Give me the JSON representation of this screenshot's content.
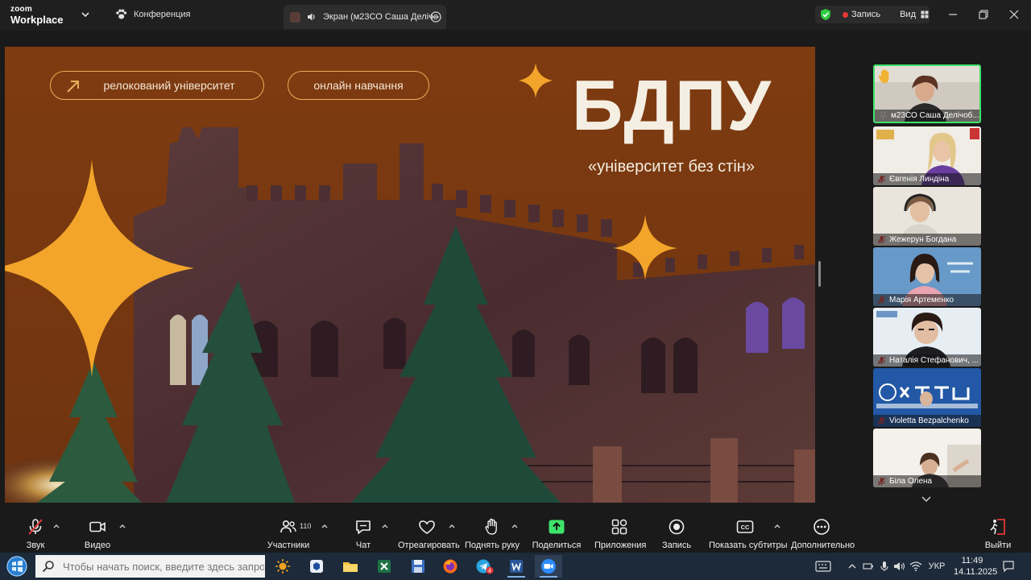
{
  "titlebar": {
    "brand_top": "zoom",
    "brand_bottom": "Workplace",
    "conference_label": "Конференция",
    "share_tab_label": "Экран (м23СО Саша Делічо",
    "record_label": "Запись",
    "view_label": "Вид"
  },
  "slide": {
    "pill_relocated": "релокований університет",
    "pill_online": "онлайн навчання",
    "title": "БДПУ",
    "subtitle": "«університет без стін»",
    "colors": {
      "background": "#7e3a10",
      "star": "#f2a52a",
      "text": "#f5eee2"
    }
  },
  "participants": [
    {
      "name": "м23СО Саша Делічоб...",
      "active": true,
      "hand_raised": true
    },
    {
      "name": "Євгенія Линдіна",
      "active": false
    },
    {
      "name": "Жежерун Богдана",
      "active": false
    },
    {
      "name": "Марія Артеменко",
      "active": false
    },
    {
      "name": "Наталія Стефанович, ...",
      "active": false
    },
    {
      "name": "Violetta Bezpalchenko",
      "active": false
    },
    {
      "name": "Біла Олена",
      "active": false
    }
  ],
  "toolbar": {
    "audio": "Звук",
    "video": "Видео",
    "participants": "Участники",
    "participants_count": "110",
    "chat": "Чат",
    "react": "Отреагировать",
    "raise_hand": "Поднять руку",
    "share": "Поделиться",
    "apps": "Приложения",
    "record": "Запись",
    "captions": "Показать субтитры",
    "more": "Дополнительно",
    "leave": "Выйти",
    "share_color": "#3ee36a",
    "leave_color": "#e53935"
  },
  "taskbar": {
    "search_placeholder": "Чтобы начать поиск, введите здесь запрос",
    "language": "УКР",
    "time": "11:49",
    "date": "14.11.2025",
    "telegram_badge": "4"
  }
}
